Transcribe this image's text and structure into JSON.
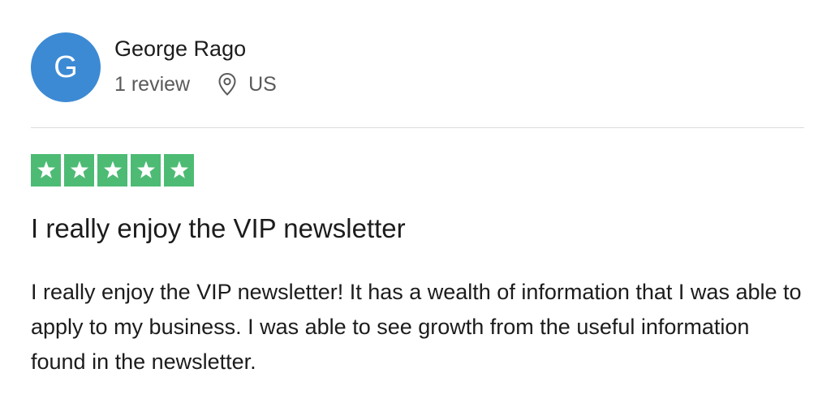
{
  "reviewer": {
    "initial": "G",
    "name": "George Rago",
    "review_count": "1 review",
    "location": "US",
    "avatar_color": "#3c8ad4"
  },
  "rating": {
    "stars": 5,
    "max_stars": 5,
    "star_color": "#4dbb74",
    "icon": "star-icon"
  },
  "review": {
    "title": "I really enjoy the VIP newsletter",
    "body": "I really enjoy the VIP newsletter! It has a wealth of information that I was able to apply to my business. I was able to see growth from the useful information found in the newsletter."
  },
  "icons": {
    "location": "location-pin-icon"
  }
}
